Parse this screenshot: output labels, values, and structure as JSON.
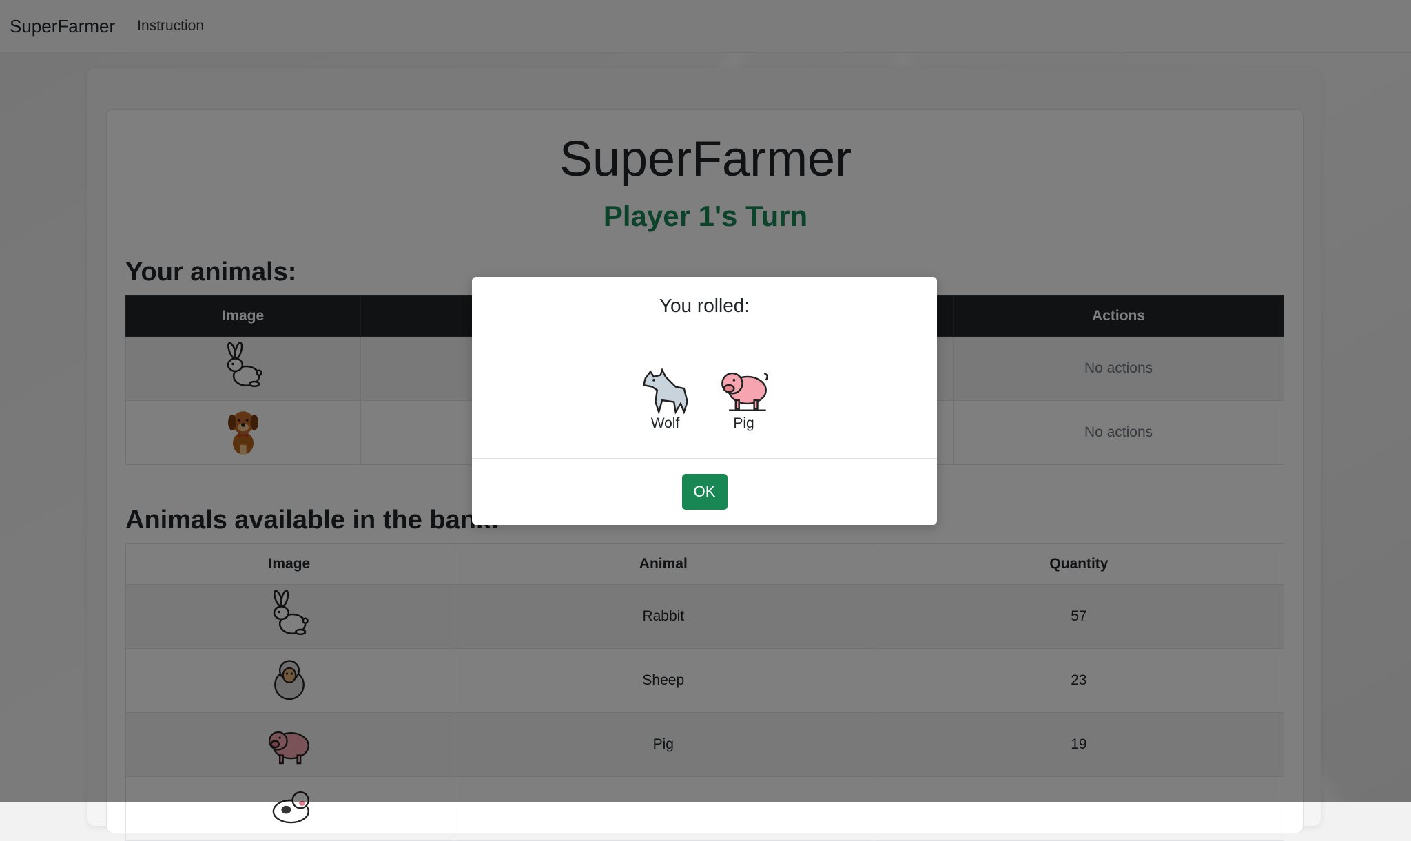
{
  "navbar": {
    "brand": "SuperFarmer",
    "instruction": "Instruction"
  },
  "game": {
    "title": "SuperFarmer",
    "turn": "Player 1's Turn"
  },
  "your_animals": {
    "heading": "Your animals:",
    "columns": [
      "Image",
      "Actions"
    ],
    "rows": [
      {
        "icon": "rabbit-icon",
        "actions": "No actions"
      },
      {
        "icon": "dog-icon",
        "actions": "No actions"
      }
    ]
  },
  "bank": {
    "heading": "Animals available in the bank:",
    "columns": [
      "Image",
      "Animal",
      "Quantity"
    ],
    "rows": [
      {
        "icon": "rabbit-icon",
        "animal": "Rabbit",
        "quantity": "57"
      },
      {
        "icon": "sheep-icon",
        "animal": "Sheep",
        "quantity": "23"
      },
      {
        "icon": "pig-icon",
        "animal": "Pig",
        "quantity": "19"
      }
    ]
  },
  "modal": {
    "title": "You rolled:",
    "dice": [
      {
        "icon": "wolf-icon",
        "label": "Wolf"
      },
      {
        "icon": "pig-icon",
        "label": "Pig"
      }
    ],
    "ok_label": "OK"
  },
  "colors": {
    "accent": "#198754",
    "table_dark": "#212529"
  }
}
